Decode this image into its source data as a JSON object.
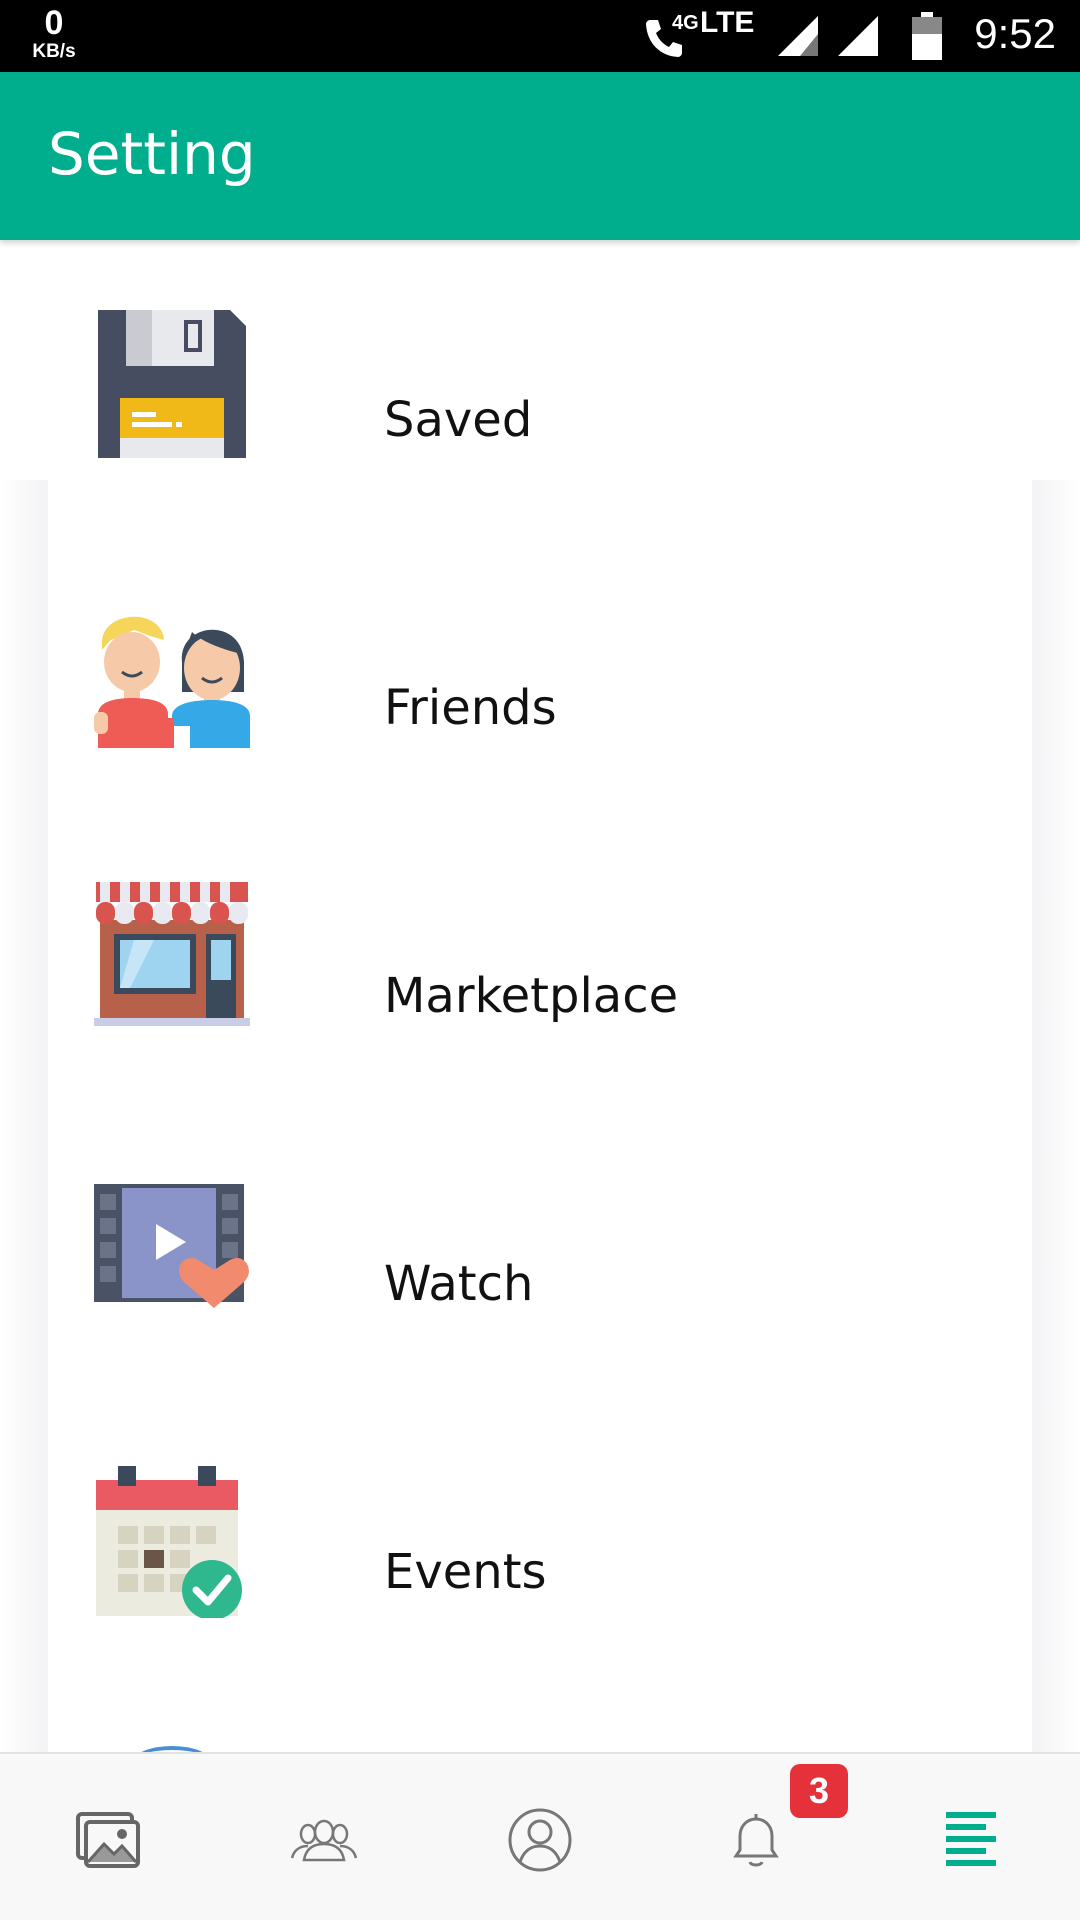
{
  "status_bar": {
    "speed_value": "0",
    "speed_unit": "KB/s",
    "network": "LTE",
    "volte": "4G",
    "time": "9:52"
  },
  "header": {
    "title": "Setting",
    "background_color": "#00ae8e"
  },
  "menu": {
    "items": [
      {
        "label": "Saved",
        "icon": "floppy-disk-icon"
      },
      {
        "label": "Friends",
        "icon": "friends-icon"
      },
      {
        "label": "Marketplace",
        "icon": "storefront-icon"
      },
      {
        "label": "Watch",
        "icon": "video-heart-icon"
      },
      {
        "label": "Events",
        "icon": "calendar-check-icon"
      }
    ]
  },
  "bottom_nav": {
    "items": [
      {
        "icon": "photos-icon"
      },
      {
        "icon": "groups-icon"
      },
      {
        "icon": "profile-icon"
      },
      {
        "icon": "bell-icon",
        "badge": "3"
      },
      {
        "icon": "menu-lines-icon",
        "active": true
      }
    ],
    "active_color": "#00ae8e",
    "badge_color": "#e5323a"
  }
}
